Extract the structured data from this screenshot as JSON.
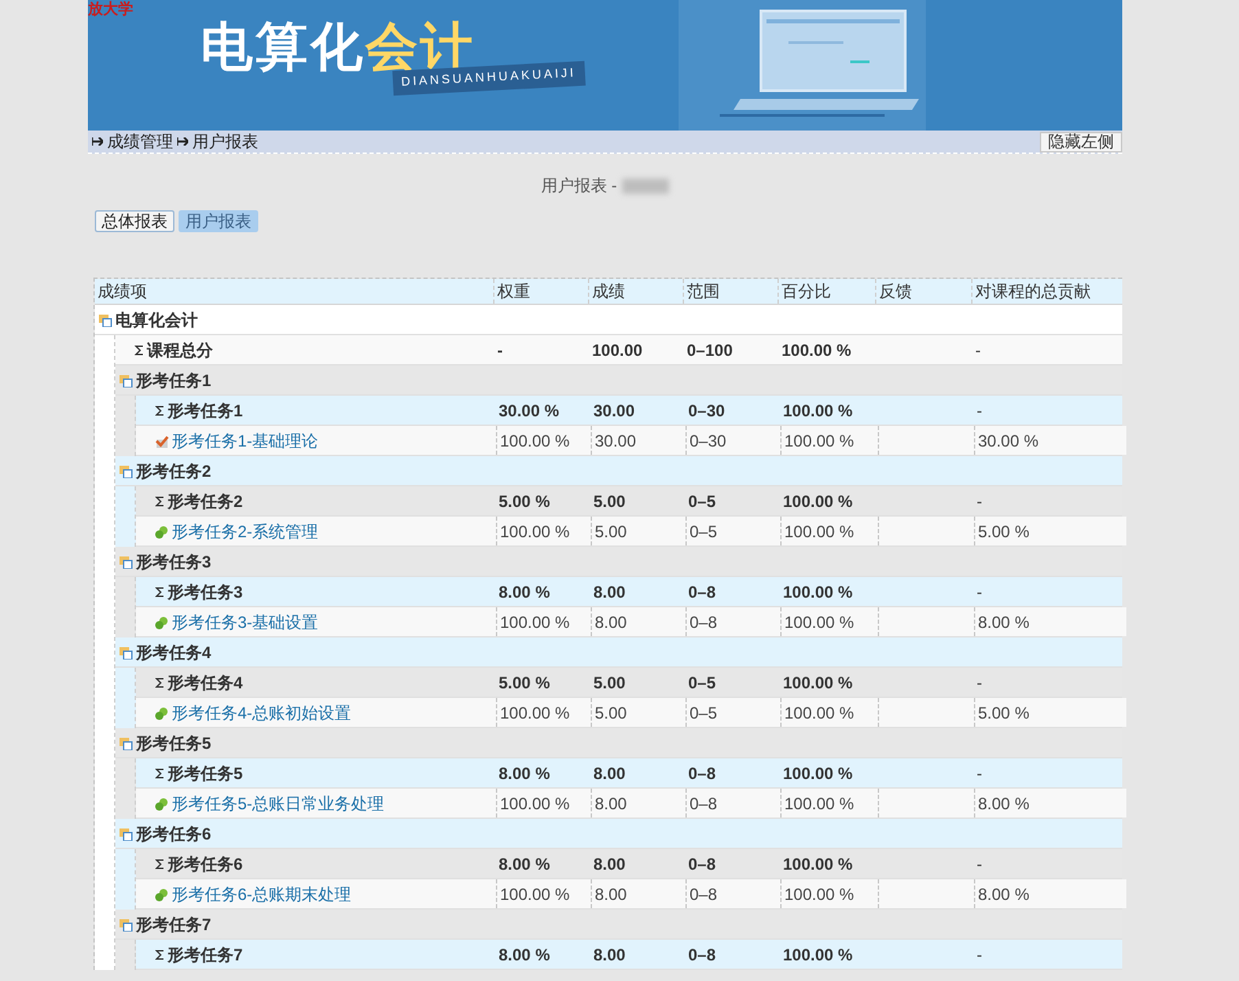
{
  "banner": {
    "logo": "放大学",
    "title_main": "电算化",
    "title_accent": "会计",
    "subtitle": "DIANSUANHUAKUAIJI"
  },
  "breadcrumb": [
    "成绩管理",
    "用户报表"
  ],
  "hide_button": "隐藏左侧",
  "report_title": "用户报表 -",
  "tabs": [
    {
      "label": "总体报表",
      "selected": false
    },
    {
      "label": "用户报表",
      "selected": true
    }
  ],
  "table": {
    "columns": [
      "成绩项",
      "权重",
      "成绩",
      "范围",
      "百分比",
      "反馈",
      "对课程的总贡献"
    ],
    "course": {
      "name": "电算化会计",
      "children": [
        {
          "kind": "total",
          "name": "课程总分",
          "weight": "-",
          "grade": "100.00",
          "range": "0–100",
          "percentage": "100.00 %",
          "contribution": "-"
        },
        {
          "kind": "category",
          "name": "形考任务1",
          "children": [
            {
              "kind": "total",
              "name": "形考任务1",
              "weight": "30.00 %",
              "grade": "30.00",
              "range": "0–30",
              "percentage": "100.00 %",
              "contribution": "-"
            },
            {
              "kind": "quiz",
              "name": "形考任务1-基础理论",
              "weight": "100.00 %",
              "grade": "30.00",
              "range": "0–30",
              "percentage": "100.00 %",
              "contribution": "30.00 %"
            }
          ]
        },
        {
          "kind": "category",
          "name": "形考任务2",
          "children": [
            {
              "kind": "total",
              "name": "形考任务2",
              "weight": "5.00 %",
              "grade": "5.00",
              "range": "0–5",
              "percentage": "100.00 %",
              "contribution": "-"
            },
            {
              "kind": "activity",
              "name": "形考任务2-系统管理",
              "weight": "100.00 %",
              "grade": "5.00",
              "range": "0–5",
              "percentage": "100.00 %",
              "contribution": "5.00 %"
            }
          ]
        },
        {
          "kind": "category",
          "name": "形考任务3",
          "children": [
            {
              "kind": "total",
              "name": "形考任务3",
              "weight": "8.00 %",
              "grade": "8.00",
              "range": "0–8",
              "percentage": "100.00 %",
              "contribution": "-"
            },
            {
              "kind": "activity",
              "name": "形考任务3-基础设置",
              "weight": "100.00 %",
              "grade": "8.00",
              "range": "0–8",
              "percentage": "100.00 %",
              "contribution": "8.00 %"
            }
          ]
        },
        {
          "kind": "category",
          "name": "形考任务4",
          "children": [
            {
              "kind": "total",
              "name": "形考任务4",
              "weight": "5.00 %",
              "grade": "5.00",
              "range": "0–5",
              "percentage": "100.00 %",
              "contribution": "-"
            },
            {
              "kind": "activity",
              "name": "形考任务4-总账初始设置",
              "weight": "100.00 %",
              "grade": "5.00",
              "range": "0–5",
              "percentage": "100.00 %",
              "contribution": "5.00 %"
            }
          ]
        },
        {
          "kind": "category",
          "name": "形考任务5",
          "children": [
            {
              "kind": "total",
              "name": "形考任务5",
              "weight": "8.00 %",
              "grade": "8.00",
              "range": "0–8",
              "percentage": "100.00 %",
              "contribution": "-"
            },
            {
              "kind": "activity",
              "name": "形考任务5-总账日常业务处理",
              "weight": "100.00 %",
              "grade": "8.00",
              "range": "0–8",
              "percentage": "100.00 %",
              "contribution": "8.00 %"
            }
          ]
        },
        {
          "kind": "category",
          "name": "形考任务6",
          "children": [
            {
              "kind": "total",
              "name": "形考任务6",
              "weight": "8.00 %",
              "grade": "8.00",
              "range": "0–8",
              "percentage": "100.00 %",
              "contribution": "-"
            },
            {
              "kind": "activity",
              "name": "形考任务6-总账期末处理",
              "weight": "100.00 %",
              "grade": "8.00",
              "range": "0–8",
              "percentage": "100.00 %",
              "contribution": "8.00 %"
            }
          ]
        },
        {
          "kind": "category",
          "name": "形考任务7",
          "children": [
            {
              "kind": "total",
              "name": "形考任务7",
              "weight": "8.00 %",
              "grade": "8.00",
              "range": "0–8",
              "percentage": "100.00 %",
              "contribution": "-"
            }
          ]
        }
      ]
    }
  }
}
